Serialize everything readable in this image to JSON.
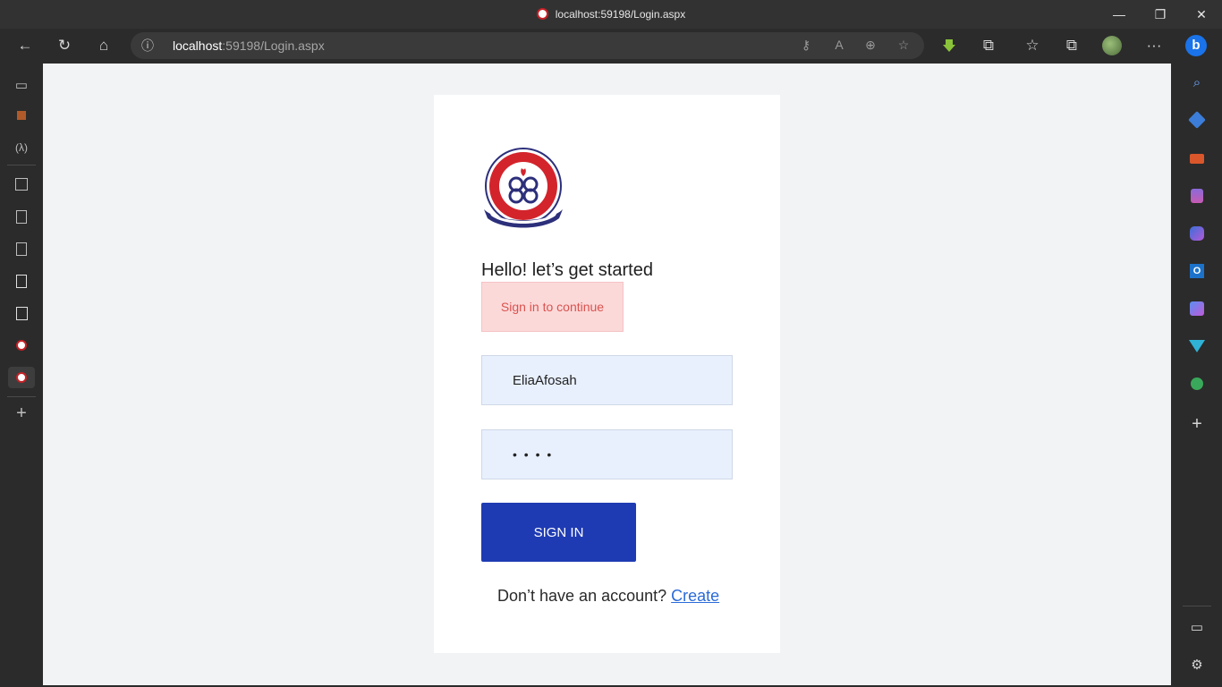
{
  "window": {
    "title": "localhost:59198/Login.aspx",
    "minimize_glyph": "—",
    "restore_glyph": "❐",
    "close_glyph": "✕"
  },
  "toolbar": {
    "back_glyph": "←",
    "refresh_glyph": "↻",
    "home_glyph": "⌂",
    "url_host": "localhost",
    "url_rest": ":59198/Login.aspx",
    "menu_glyph": "···"
  },
  "icons": {
    "info": "ⓘ",
    "key": "⚷",
    "read_aloud": "A",
    "zoom": "⊕",
    "favorite_add": "☆",
    "extensions": "⧉",
    "favorites": "☆",
    "collections": "⧉",
    "tabs": "▭",
    "plus": "+",
    "search": "⌕",
    "settings": "⚙"
  },
  "colors": {
    "accent_button": "#1f3bb3",
    "alert_bg": "#fbd9d9",
    "alert_text": "#d9534f",
    "link": "#2a6bd8",
    "input_bg": "#e8f0fe"
  },
  "login": {
    "greeting": "Hello! let’s get started",
    "alert": "Sign in to continue",
    "username_value": "EliaAfosah",
    "password_masked": "• • • •",
    "signin_label": "SIGN IN",
    "footer_text": "Don’t have an account? ",
    "create_link": "Create"
  }
}
